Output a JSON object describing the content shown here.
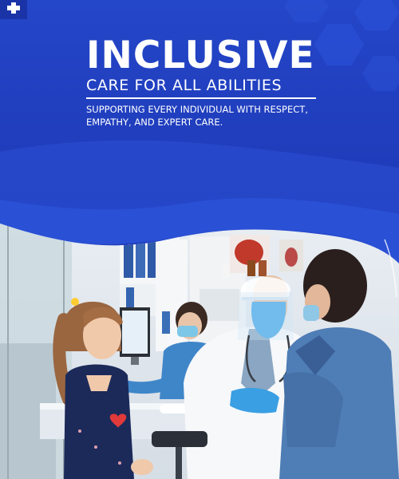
{
  "headline": {
    "title": "INCLUSIVE",
    "subtitle": "CARE FOR ALL ABILITIES",
    "tagline_line1": "SUPPORTING EVERY INDIVIDUAL WITH RESPECT,",
    "tagline_line2": "EMPATHY, AND EXPERT CARE."
  },
  "colors": {
    "background": "#1f3cbb",
    "wave_light": "#2d52d6",
    "text": "#ffffff"
  },
  "photo": {
    "scene": "doctor-consultation-photo"
  }
}
